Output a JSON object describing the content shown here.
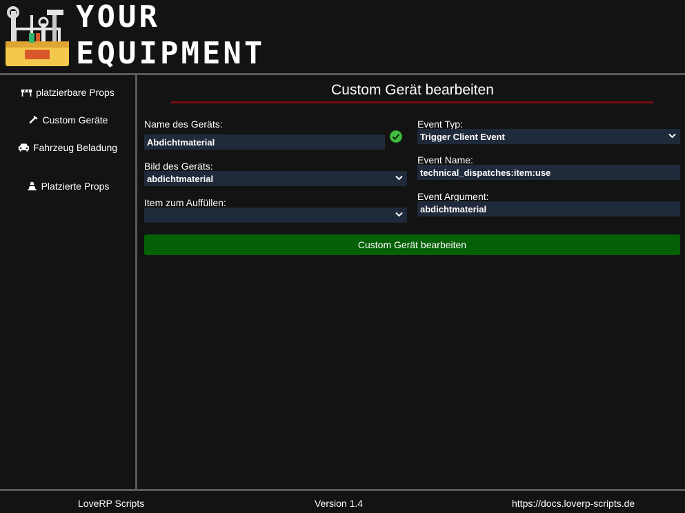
{
  "app": {
    "logo_line1": "YOUR",
    "logo_line2": "EQUIPMENT",
    "logo_icon": "toolbox-icon"
  },
  "sidebar": {
    "items": [
      {
        "label": "platzierbare Props",
        "icon": "barrier-icon"
      },
      {
        "label": "Custom Geräte",
        "icon": "hammer-icon"
      },
      {
        "label": "Fahrzeug Beladung",
        "icon": "car-icon"
      },
      {
        "label": "Platzierte Props",
        "icon": "traffic-cone-icon"
      }
    ]
  },
  "form": {
    "title": "Custom Gerät bearbeiten",
    "name_label": "Name des Geräts:",
    "name_value": "Abdichtmaterial",
    "name_valid_icon": "check-circle-icon",
    "image_label": "Bild des Geräts:",
    "image_value": "abdichtmaterial",
    "refill_label": "Item zum Auffüllen:",
    "refill_value": "",
    "event_type_label": "Event Typ:",
    "event_type_value": "Trigger Client Event",
    "event_name_label": "Event Name:",
    "event_name_value": "technical_dispatches:item:use",
    "event_arg_label": "Event Argument:",
    "event_arg_value": "abdichtmaterial",
    "submit_label": "Custom Gerät bearbeiten"
  },
  "footer": {
    "left": "LoveRP Scripts",
    "center": "Version 1.4",
    "right": "https://docs.loverp-scripts.de"
  },
  "colors": {
    "background": "#131313",
    "separator": "#5a5a5a",
    "title_underline": "#7a0b0b",
    "field_bg": "#1f2a3a",
    "submit_bg": "#056005",
    "valid_green": "#3fbf3f"
  }
}
